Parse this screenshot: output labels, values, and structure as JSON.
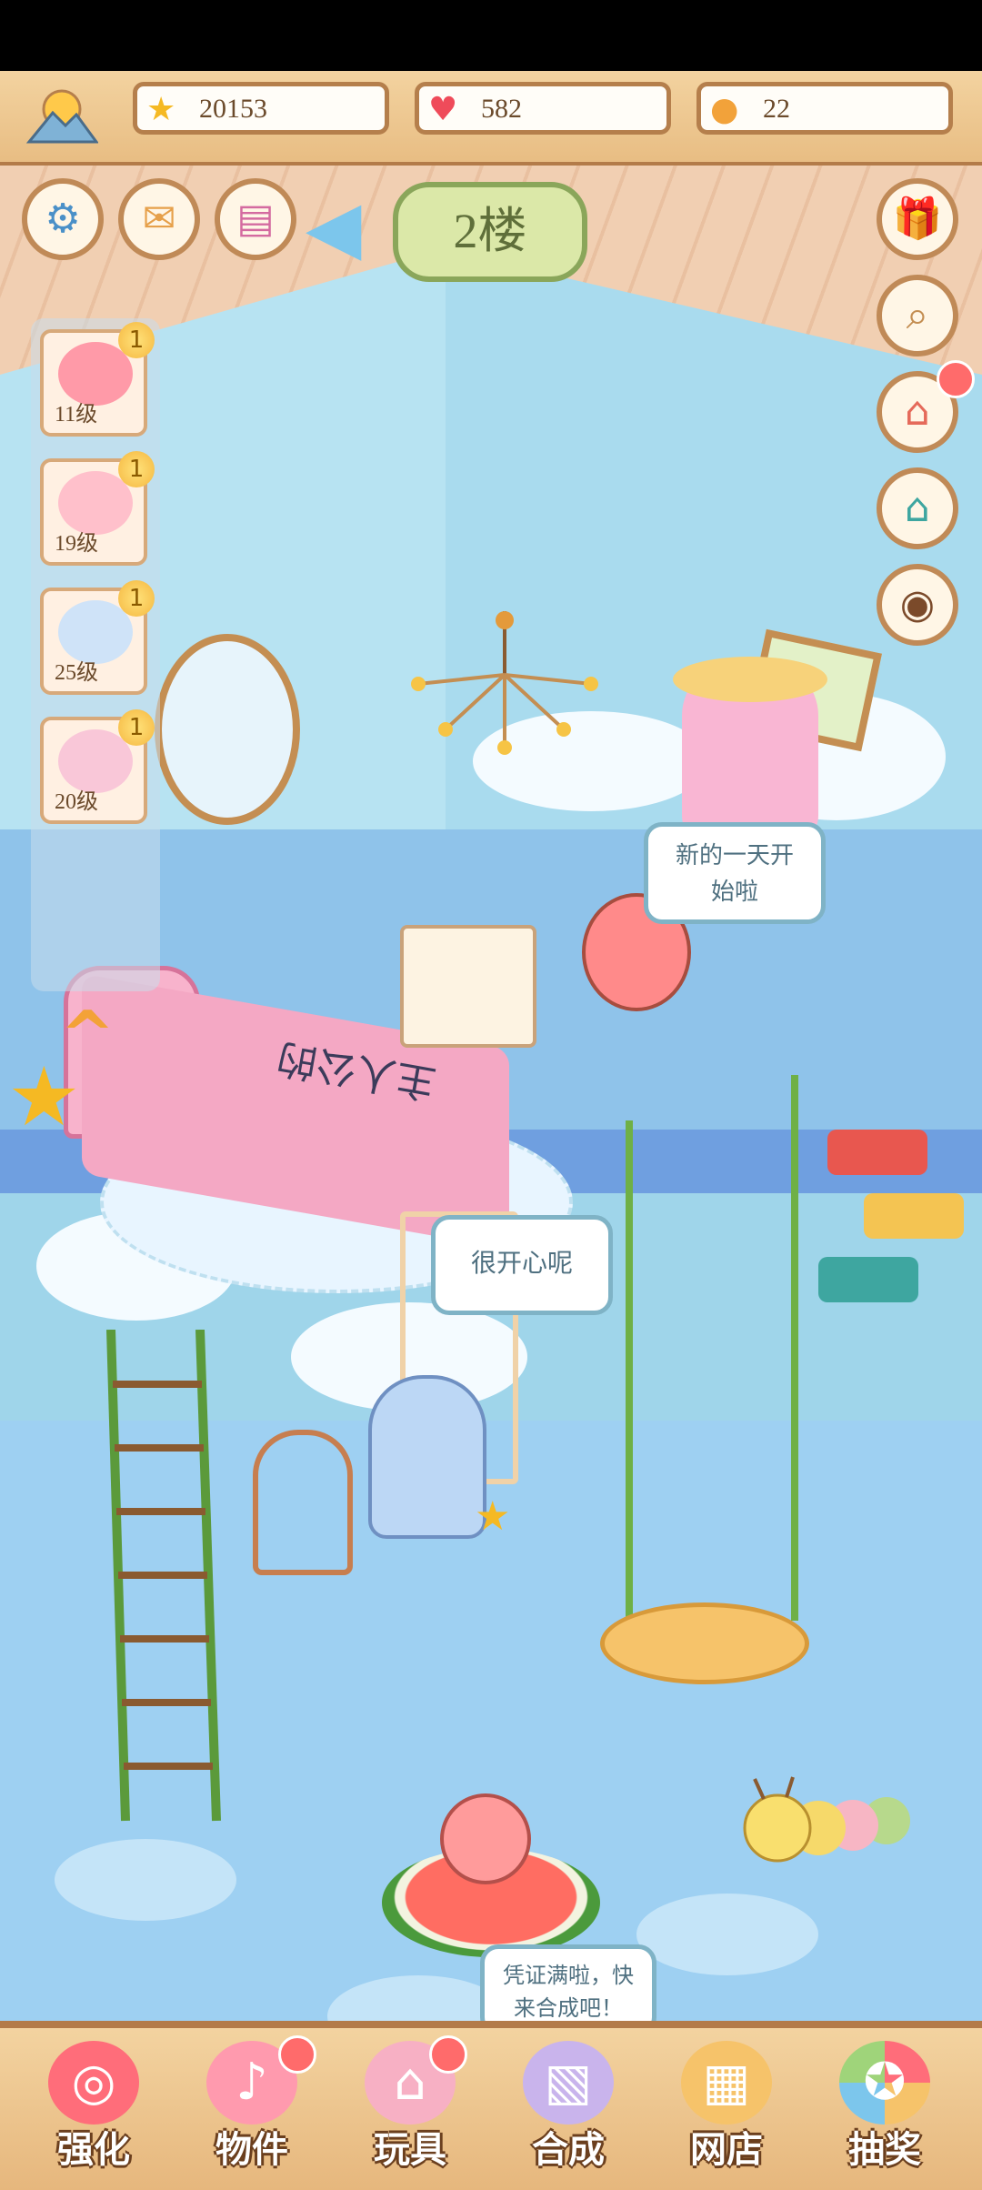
{
  "top_bar": {
    "stars": "20153",
    "hearts": "582",
    "paw_coins": "22",
    "icons": [
      "sun-mountain-icon",
      "star-icon",
      "heart-icon",
      "paw-coin-icon"
    ]
  },
  "floor_label": "2楼",
  "characters": [
    {
      "level": "11级",
      "badge": "1"
    },
    {
      "level": "19级",
      "badge": "1"
    },
    {
      "level": "25级",
      "badge": "1"
    },
    {
      "level": "20级",
      "badge": "1"
    }
  ],
  "bubbles": {
    "girl": "新的一天开始啦",
    "shelf": "很开心呢",
    "merge_hint": "凭证满啦，快来合成吧！"
  },
  "bed_book_text": "主人公的",
  "bottom_nav": [
    {
      "label": "强化",
      "icon": "lollipop-icon"
    },
    {
      "label": "物件",
      "icon": "piano-icon"
    },
    {
      "label": "玩具",
      "icon": "toy-house-icon"
    },
    {
      "label": "合成",
      "icon": "cards-icon"
    },
    {
      "label": "网店",
      "icon": "shop-icon"
    },
    {
      "label": "抽奖",
      "icon": "lottery-wheel-icon"
    }
  ],
  "colors": {
    "accent_brown": "#b57f4c",
    "red_dot": "#ff6b6b"
  }
}
